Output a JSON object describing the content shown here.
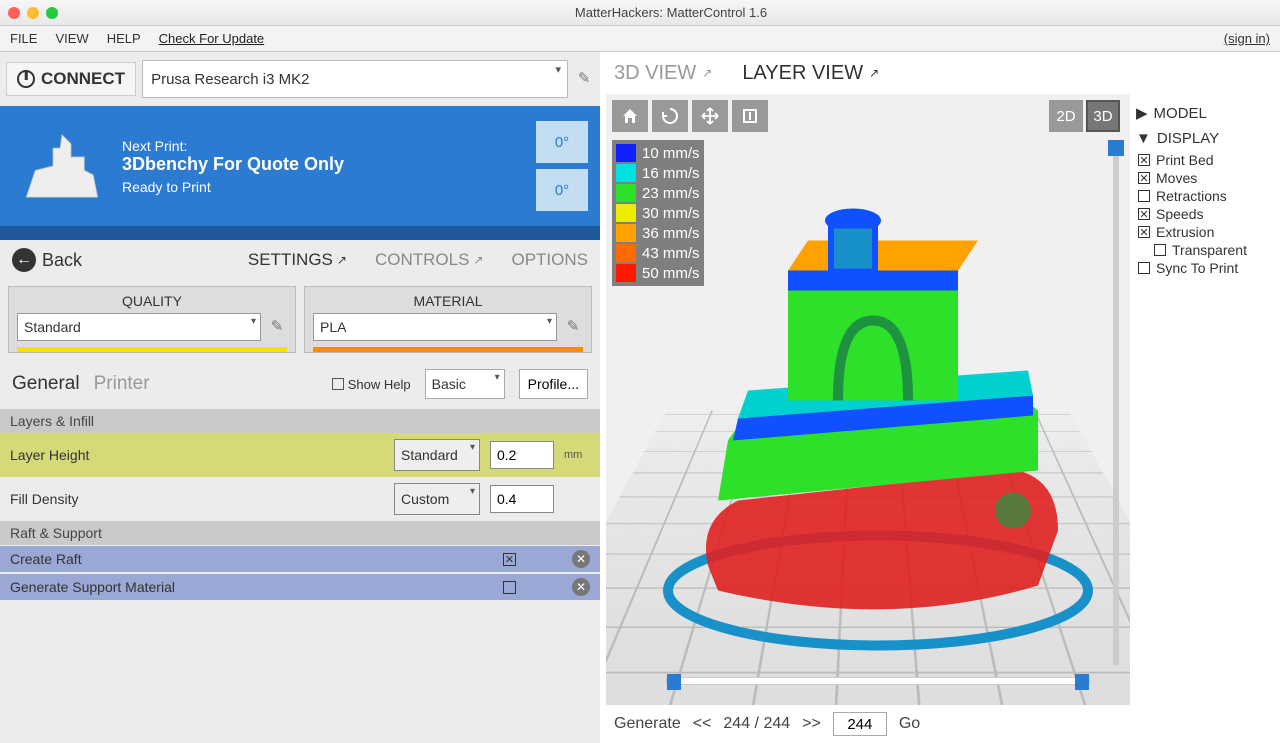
{
  "window_title": "MatterHackers: MatterControl 1.6",
  "menu": {
    "file": "FILE",
    "view": "VIEW",
    "help": "HELP",
    "check_update": "Check For Update",
    "sign_in": "(sign in)"
  },
  "connect": {
    "label": "CONNECT",
    "printer": "Prusa Research i3 MK2"
  },
  "next_print": {
    "label": "Next Print:",
    "title": "3Dbenchy For Quote Only",
    "status": "Ready to Print",
    "temps": [
      "0°",
      "0°"
    ]
  },
  "back_label": "Back",
  "tabs": {
    "settings": "SETTINGS",
    "controls": "CONTROLS",
    "options": "OPTIONS"
  },
  "quality": {
    "title": "QUALITY",
    "value": "Standard"
  },
  "material": {
    "title": "MATERIAL",
    "value": "PLA"
  },
  "general_tabs": {
    "general": "General",
    "printer": "Printer"
  },
  "show_help_label": "Show Help",
  "level_value": "Basic",
  "profile_btn": "Profile...",
  "sections": {
    "layers": "Layers & Infill",
    "raft": "Raft & Support"
  },
  "settings": {
    "layer_height": {
      "label": "Layer Height",
      "preset": "Standard",
      "value": "0.2",
      "unit": "mm"
    },
    "fill_density": {
      "label": "Fill Density",
      "preset": "Custom",
      "value": "0.4",
      "unit": ""
    }
  },
  "raft_rows": {
    "create_raft": {
      "label": "Create Raft",
      "checked": true
    },
    "generate_support": {
      "label": "Generate Support Material",
      "checked": false
    }
  },
  "view_tabs": {
    "view3d": "3D VIEW",
    "layer": "LAYER VIEW"
  },
  "dim_2d": "2D",
  "dim_3d": "3D",
  "side_panel": {
    "model": "MODEL",
    "display": "DISPLAY",
    "opts": {
      "print_bed": {
        "label": "Print Bed",
        "checked": true
      },
      "moves": {
        "label": "Moves",
        "checked": true
      },
      "retractions": {
        "label": "Retractions",
        "checked": false
      },
      "speeds": {
        "label": "Speeds",
        "checked": true
      },
      "extrusion": {
        "label": "Extrusion",
        "checked": true
      },
      "transparent": {
        "label": "Transparent",
        "checked": false
      },
      "sync_print": {
        "label": "Sync To Print",
        "checked": false
      }
    }
  },
  "speed_legend": [
    {
      "color": "#1020ff",
      "label": "10 mm/s"
    },
    {
      "color": "#00e0e0",
      "label": "16 mm/s"
    },
    {
      "color": "#2de02a",
      "label": "23 mm/s"
    },
    {
      "color": "#ecec00",
      "label": "30 mm/s"
    },
    {
      "color": "#ffa200",
      "label": "36 mm/s"
    },
    {
      "color": "#ff6a00",
      "label": "43 mm/s"
    },
    {
      "color": "#ff1a00",
      "label": "50 mm/s"
    }
  ],
  "generate_bar": {
    "generate": "Generate",
    "prev": "<<",
    "counter": "244 / 244",
    "next": ">>",
    "input": "244",
    "go": "Go"
  }
}
